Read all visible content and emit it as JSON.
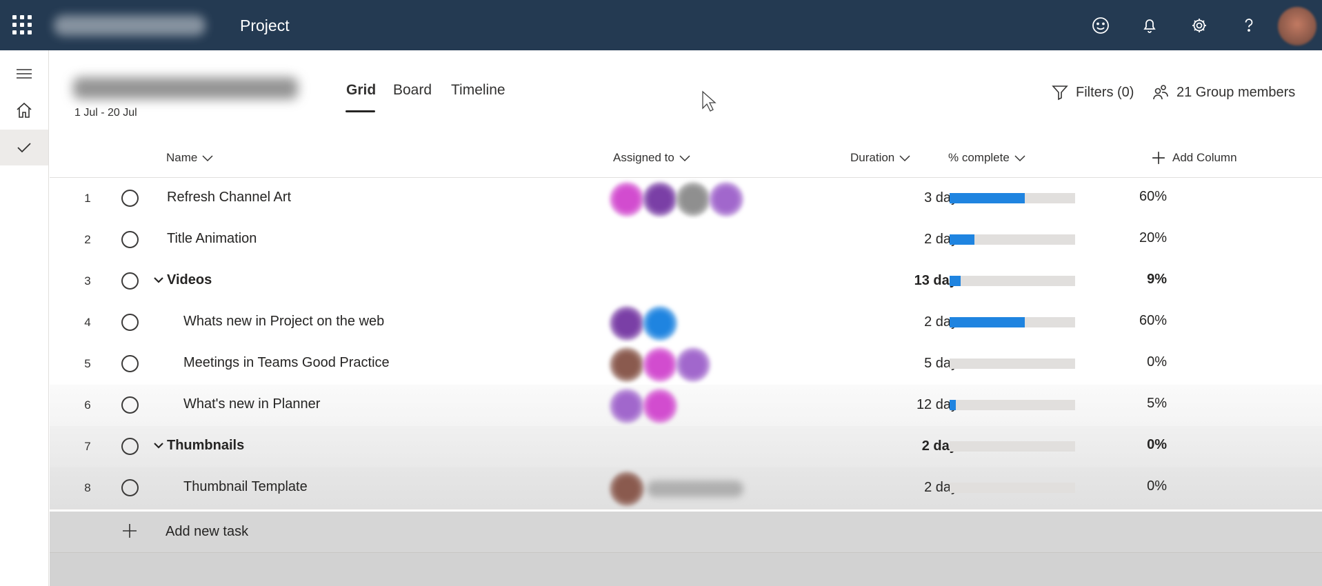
{
  "app": {
    "title": "Project"
  },
  "plan": {
    "dates": "1 Jul - 20 Jul"
  },
  "tabs": [
    {
      "label": "Grid",
      "active": true
    },
    {
      "label": "Board",
      "active": false
    },
    {
      "label": "Timeline",
      "active": false
    }
  ],
  "actions": {
    "filters": "Filters (0)",
    "members": "21 Group members"
  },
  "columns": {
    "name": "Name",
    "assigned": "Assigned to",
    "duration": "Duration",
    "complete": "% complete",
    "add": "Add Column"
  },
  "tasks": [
    {
      "num": "1",
      "name": "Refresh Channel Art",
      "duration": "3 days",
      "percent": "60%",
      "progress": 0.6,
      "summary": false,
      "indent": 0,
      "avatars": [
        "#d24ccf",
        "#7a3fa6",
        "#8f8f8f",
        "#a167cc"
      ]
    },
    {
      "num": "2",
      "name": "Title Animation",
      "duration": "2 days",
      "percent": "20%",
      "progress": 0.2,
      "summary": false,
      "indent": 0,
      "avatars": []
    },
    {
      "num": "3",
      "name": "Videos",
      "duration": "13 days",
      "percent": "9%",
      "progress": 0.09,
      "summary": true,
      "indent": 0,
      "avatars": []
    },
    {
      "num": "4",
      "name": "Whats new in Project on the web",
      "duration": "2 days",
      "percent": "60%",
      "progress": 0.6,
      "summary": false,
      "indent": 1,
      "avatars": [
        "#7a3fa6",
        "#1f84e0"
      ]
    },
    {
      "num": "5",
      "name": "Meetings in Teams Good Practice",
      "duration": "5 days",
      "percent": "0%",
      "progress": 0.0,
      "summary": false,
      "indent": 1,
      "avatars": [
        "#8a5a4e",
        "#d24ccf",
        "#a167cc"
      ]
    },
    {
      "num": "6",
      "name": "What's new in Planner",
      "duration": "12 days",
      "percent": "5%",
      "progress": 0.05,
      "summary": false,
      "indent": 1,
      "avatars": [
        "#a167cc",
        "#d24ccf"
      ]
    },
    {
      "num": "7",
      "name": "Thumbnails",
      "duration": "2 days",
      "percent": "0%",
      "progress": 0.0,
      "summary": true,
      "indent": 0,
      "avatars": []
    },
    {
      "num": "8",
      "name": "Thumbnail Template",
      "duration": "2 days",
      "percent": "0%",
      "progress": 0.0,
      "summary": false,
      "indent": 1,
      "avatars": [
        "#8a5a4e"
      ],
      "show_avatar_name": true
    }
  ],
  "add_task": {
    "label": "Add new task"
  },
  "icons": {
    "top": [
      "waffle-icon",
      "emoji-icon",
      "bell-icon",
      "gear-icon",
      "help-icon"
    ],
    "rail": [
      "hamburger-icon",
      "home-icon",
      "checkmark-icon"
    ]
  },
  "colors": {
    "topbar": "#243a52",
    "progress": "#1f84e0",
    "track": "#e1dfdd"
  }
}
